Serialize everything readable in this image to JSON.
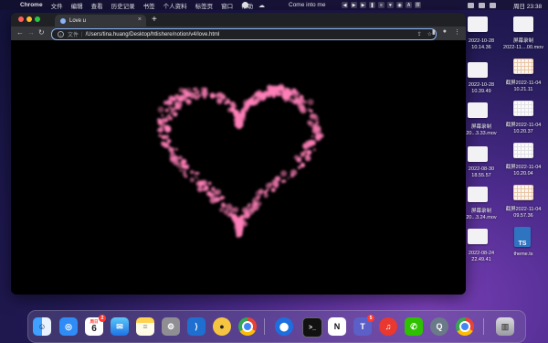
{
  "menubar": {
    "items": [
      "Chrome",
      "文件",
      "编辑",
      "查看",
      "历史记录",
      "书签",
      "个人资料",
      "标签页",
      "窗口",
      "帮助"
    ],
    "now_playing": "Come into me",
    "clock": "周日 23:38"
  },
  "browser": {
    "tab_title": "Love u",
    "url_scheme": "文件",
    "url": "/Users/tina.huang/Desktop/htlishere/notion/v4/love.html"
  },
  "desktop_files": [
    {
      "line1": "2022-10-28",
      "line2": "10.14.36"
    },
    {
      "line1": "屏幕录制",
      "line2": "2022-11....00.mov"
    },
    {
      "line1": "2022-10-28",
      "line2": "10.39.49"
    },
    {
      "line1": "截屏2022-11-04",
      "line2": "10.21.11"
    },
    {
      "line1": "屏幕录制",
      "line2": "20...3.33.mov"
    },
    {
      "line1": "截屏2022-11-04",
      "line2": "10.20.37"
    },
    {
      "line1": "2022-08-30",
      "line2": "18.55.57"
    },
    {
      "line1": "截屏2022-11-04",
      "line2": "10.20.04"
    },
    {
      "line1": "屏幕录制",
      "line2": "20...3.24.mov"
    },
    {
      "line1": "截屏2022-11-04",
      "line2": "09.57.36"
    },
    {
      "line1": "2022-08-24",
      "line2": "22.49.41"
    },
    {
      "line1": "theme.ts",
      "line2": ""
    }
  ],
  "dock": {
    "calendar_day": "6",
    "calendar_month": "周日",
    "calendar_badge": "2",
    "teams_badge": "5"
  },
  "colors": {
    "heart": "#ff7fb8",
    "viewport_bg": "#000000",
    "omnibox_focus": "#8ab4f8"
  }
}
